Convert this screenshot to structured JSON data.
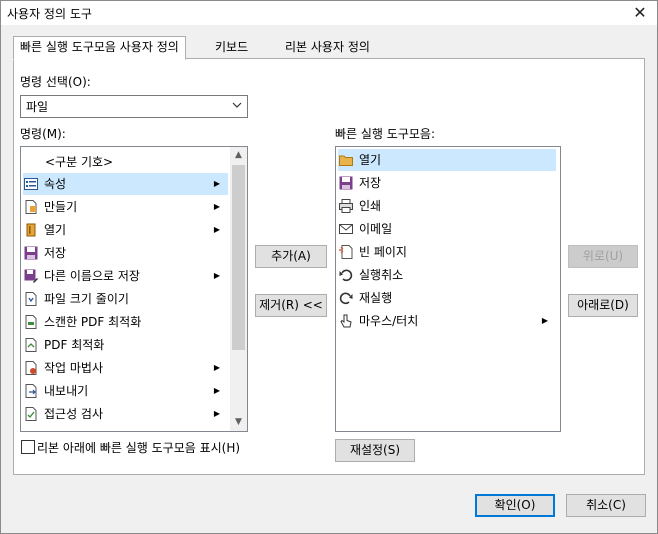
{
  "window": {
    "title": "사용자 정의 도구"
  },
  "tabs": [
    {
      "label": "빠른 실행 도구모음 사용자 정의"
    },
    {
      "label": "키보드"
    },
    {
      "label": "리본 사용자 정의"
    }
  ],
  "command_select": {
    "label": "명령 선택(O):",
    "value": "파일"
  },
  "commands": {
    "label": "명령(M):",
    "items": [
      {
        "label": "<구분 기호>",
        "icon": "none"
      },
      {
        "label": "속성",
        "icon": "properties-icon",
        "submenu": true,
        "selected": true
      },
      {
        "label": "만들기",
        "icon": "create-icon",
        "submenu": true
      },
      {
        "label": "열기",
        "icon": "open-icon",
        "submenu": true
      },
      {
        "label": "저장",
        "icon": "save-icon"
      },
      {
        "label": "다른 이름으로 저장",
        "icon": "save-as-icon",
        "submenu": true
      },
      {
        "label": "파일 크기 줄이기",
        "icon": "reduce-size-icon"
      },
      {
        "label": "스캔한 PDF 최적화",
        "icon": "optimize-scan-icon"
      },
      {
        "label": "PDF 최적화",
        "icon": "optimize-pdf-icon"
      },
      {
        "label": "작업 마법사",
        "icon": "wizard-icon",
        "submenu": true
      },
      {
        "label": "내보내기",
        "icon": "export-icon",
        "submenu": true
      },
      {
        "label": "접근성 검사",
        "icon": "accessibility-icon",
        "submenu": true
      }
    ]
  },
  "buttons": {
    "add": "추가(A)",
    "remove": "제거(R) <<",
    "up": "위로(U)",
    "down": "아래로(D)",
    "reset": "재설정(S)",
    "ok": "확인(O)",
    "cancel": "취소(C)"
  },
  "toolbar_list": {
    "label": "빠른 실행 도구모음:",
    "items": [
      {
        "label": "열기",
        "icon": "folder-icon",
        "selected": true
      },
      {
        "label": "저장",
        "icon": "save-icon"
      },
      {
        "label": "인쇄",
        "icon": "print-icon"
      },
      {
        "label": "이메일",
        "icon": "email-icon"
      },
      {
        "label": "빈 페이지",
        "icon": "blank-page-icon"
      },
      {
        "label": "실행취소",
        "icon": "undo-icon"
      },
      {
        "label": "재실행",
        "icon": "redo-icon"
      },
      {
        "label": "마우스/터치",
        "icon": "touch-icon",
        "submenu": true
      }
    ]
  },
  "checkbox": {
    "label": "리본 아래에 빠른 실행 도구모음 표시(H)",
    "checked": false
  },
  "colors": {
    "selection": "#cce8ff",
    "accent": "#0078d7"
  }
}
